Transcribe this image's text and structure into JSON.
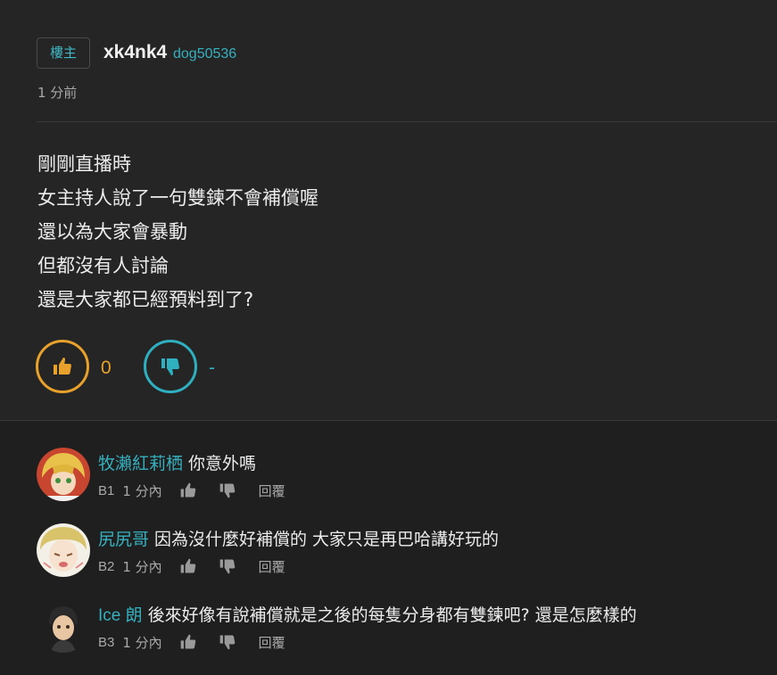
{
  "post": {
    "op_badge": "樓主",
    "author_name": "xk4nk4",
    "author_id": "dog50536",
    "time": "1 分前",
    "body_lines": [
      "剛剛直播時",
      "女主持人說了一句雙鍊不會補償喔",
      "還以為大家會暴動",
      "但都沒有人討論",
      "還是大家都已經預料到了?"
    ],
    "upvotes": "0",
    "downvotes": "-"
  },
  "replies": [
    {
      "user": "牧瀨紅莉栖",
      "text": "你意外嗎",
      "floor": "B1",
      "time": "1 分內",
      "reply_label": "回覆"
    },
    {
      "user": "尻尻哥",
      "text": "因為沒什麼好補償的 大家只是再巴哈講好玩的",
      "floor": "B2",
      "time": "1 分內",
      "reply_label": "回覆"
    },
    {
      "user": "Ice 朗",
      "text": "後來好像有說補償就是之後的每隻分身都有雙鍊吧? 還是怎麼樣的",
      "floor": "B3",
      "time": "1 分內",
      "reply_label": "回覆"
    }
  ],
  "icons": {
    "upvote": "thumbs-up-icon",
    "downvote": "thumbs-down-icon"
  },
  "colors": {
    "upvote_accent": "#e8a22c",
    "downvote_accent": "#2fb0c0",
    "username": "#36b0bf",
    "background": "#1f1f1f",
    "post_background": "#252525"
  }
}
